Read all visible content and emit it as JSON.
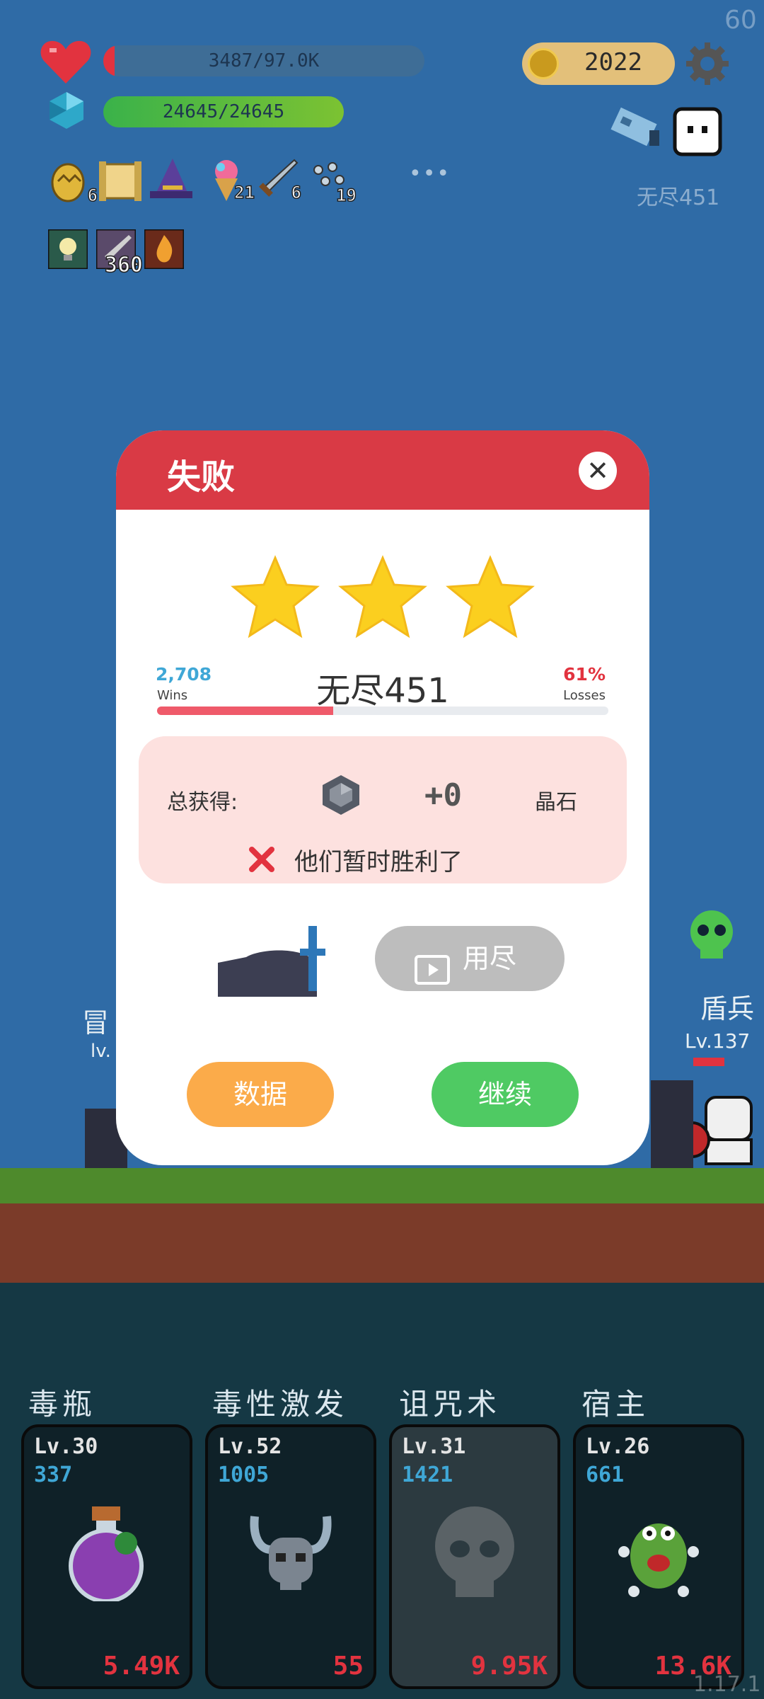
{
  "hud": {
    "fps": "60",
    "hp_text": "3487/97.0K",
    "hp_fraction": 0.036,
    "mana_text": "24645/24645",
    "mana_fraction": 1.0,
    "coins": "2022",
    "stage_label": "无尽451",
    "items": [
      {
        "icon": "golden-egg-icon",
        "count": "6"
      },
      {
        "icon": "scroll-icon",
        "count": ""
      },
      {
        "icon": "wizard-hat-icon",
        "count": ""
      },
      {
        "icon": "ice-cream-icon",
        "count": "21"
      },
      {
        "icon": "sword-icon",
        "count": "6"
      },
      {
        "icon": "sparkle-cluster-icon",
        "count": "19"
      }
    ],
    "more_label": "•••",
    "buffs": [
      {
        "icon": "light-bulb-icon",
        "count": ""
      },
      {
        "icon": "blade-icon",
        "count": "360"
      },
      {
        "icon": "fire-icon",
        "count": ""
      }
    ]
  },
  "modal": {
    "title": "失败",
    "close_label": "✕",
    "stars": 3,
    "wins": "2,708",
    "wins_label": "Wins",
    "stage": "无尽451",
    "losses_pct": "61%",
    "losses_label": "Losses",
    "win_fraction": 0.39,
    "reward_label": "总获得:",
    "reward_amount": "+0",
    "reward_unit": "晶石",
    "result_message": "他们暂时胜利了",
    "video_button": "用尽",
    "data_button": "数据",
    "continue_button": "继续"
  },
  "scene": {
    "left_unit_name": "冒",
    "left_unit_lv": "lv.",
    "right_unit_name": "盾兵",
    "right_unit_lv": "Lv.137"
  },
  "skills": [
    {
      "name": "毒瓶",
      "lv": "Lv.30",
      "value": "337",
      "cost": "5.49K",
      "icon": "poison-bottle-icon"
    },
    {
      "name": "毒性激发",
      "lv": "Lv.52",
      "value": "1005",
      "cost": "55",
      "icon": "horned-helmet-skull-icon"
    },
    {
      "name": "诅咒术",
      "lv": "Lv.31",
      "value": "1421",
      "cost": "9.95K",
      "icon": "skull-icon"
    },
    {
      "name": "宿主",
      "lv": "Lv.26",
      "value": "661",
      "cost": "13.6K",
      "icon": "green-monster-icon"
    }
  ],
  "version": "1.17.1",
  "colors": {
    "header_red": "#d93a45",
    "continue_green": "#4fca63",
    "data_orange": "#fbab4a",
    "hp_red": "#e2333f",
    "mana_green": "#39b54a"
  }
}
